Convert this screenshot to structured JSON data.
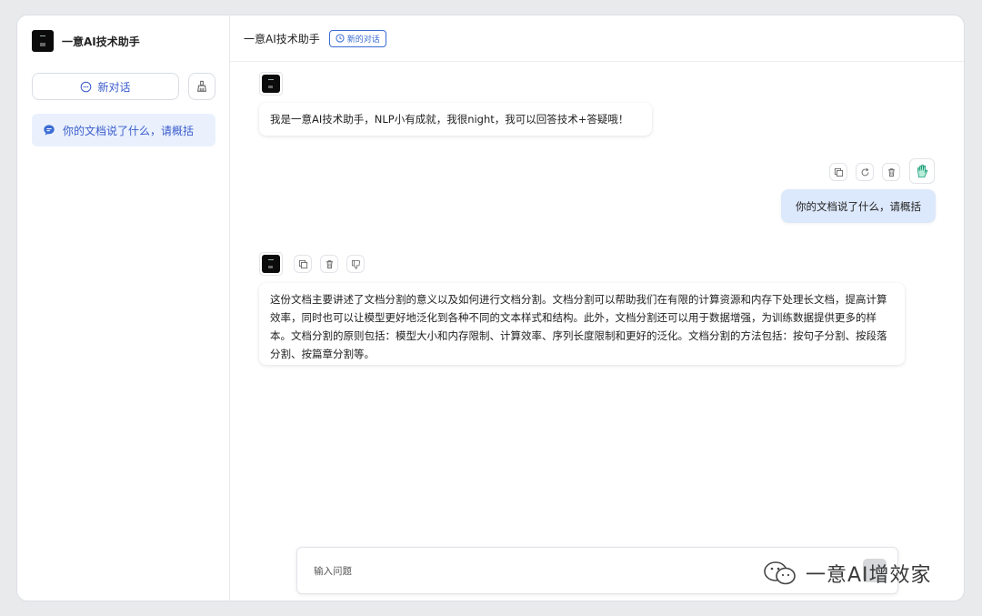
{
  "sidebar": {
    "brand_title": "一意AI技术助手",
    "new_chat_label": "新对话",
    "sessions": [
      {
        "label": "你的文档说了什么，请概括"
      }
    ]
  },
  "header": {
    "title": "一意AI技术助手",
    "badge_label": "新的对话"
  },
  "messages": [
    {
      "role": "bot",
      "text": "我是一意AI技术助手，NLP小有成就，我很night，我可以回答技术+答疑哦！"
    },
    {
      "role": "user",
      "text": "你的文档说了什么，请概括"
    },
    {
      "role": "bot",
      "text": "这份文档主要讲述了文档分割的意义以及如何进行文档分割。文档分割可以帮助我们在有限的计算资源和内存下处理长文档，提高计算效率，同时也可以让模型更好地泛化到各种不同的文本样式和结构。此外，文档分割还可以用于数据增强，为训练数据提供更多的样本。文档分割的原则包括：模型大小和内存限制、计算效率、序列长度限制和更好的泛化。文档分割的方法包括：按句子分割、按段落分割、按篇章分割等。"
    }
  ],
  "input": {
    "placeholder": "输入问题"
  },
  "watermark": {
    "text": "一意AI增效家"
  },
  "colors": {
    "accent": "#3b5ccc",
    "user_bubble": "#dce8fb",
    "session_active": "#eaf1fd"
  }
}
